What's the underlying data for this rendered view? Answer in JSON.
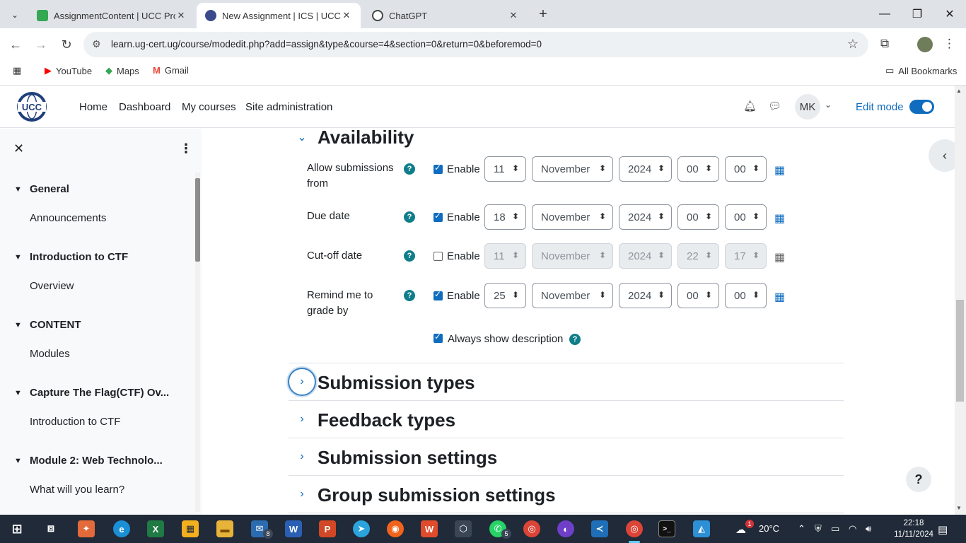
{
  "browser": {
    "tabs": [
      {
        "title": "AssignmentContent | UCC Proje",
        "active": false,
        "icon_color": "#34a853"
      },
      {
        "title": "New Assignment | ICS | UCC-CC",
        "active": true,
        "icon_color": "#3b4a8c"
      },
      {
        "title": "ChatGPT",
        "active": false,
        "icon_color": "#444444"
      }
    ],
    "url_host": "learn.ug-cert.ug",
    "url_path": "/course/modedit.php?add=assign&type=course=4&section=0&return=0&beforemod=0",
    "url_full": "learn.ug-cert.ug/course/modedit.php?add=assign&type&course=4&section=0&return=0&beforemod=0",
    "bookmarks": [
      {
        "label": "YouTube",
        "icon": "youtube-icon"
      },
      {
        "label": "Maps",
        "icon": "maps-icon"
      },
      {
        "label": "Gmail",
        "icon": "gmail-icon"
      }
    ],
    "all_bookmarks": "All Bookmarks"
  },
  "navbar": {
    "logo_text": "UCC",
    "links": [
      "Home",
      "Dashboard",
      "My courses",
      "Site administration"
    ],
    "user_initials": "MK",
    "edit_mode_label": "Edit mode",
    "edit_mode_on": true
  },
  "drawer": {
    "sections": [
      {
        "title": "General",
        "items": [
          "Announcements"
        ]
      },
      {
        "title": "Introduction to CTF",
        "items": [
          "Overview"
        ]
      },
      {
        "title": "CONTENT",
        "items": [
          "Modules"
        ]
      },
      {
        "title": "Capture The Flag(CTF) Ov...",
        "items": [
          "Introduction to CTF"
        ]
      },
      {
        "title": "Module 2: Web Technolo...",
        "items": [
          "What will you learn?"
        ]
      }
    ]
  },
  "availability": {
    "title": "Availability",
    "enable_label": "Enable",
    "rows": [
      {
        "label": "Allow submissions from",
        "enabled": true,
        "day": "11",
        "month": "November",
        "year": "2024",
        "hour": "00",
        "minute": "00"
      },
      {
        "label": "Due date",
        "enabled": true,
        "day": "18",
        "month": "November",
        "year": "2024",
        "hour": "00",
        "minute": "00"
      },
      {
        "label": "Cut-off date",
        "enabled": false,
        "day": "11",
        "month": "November",
        "year": "2024",
        "hour": "22",
        "minute": "17"
      },
      {
        "label": "Remind me to grade by",
        "enabled": true,
        "day": "25",
        "month": "November",
        "year": "2024",
        "hour": "00",
        "minute": "00"
      }
    ],
    "always_show_description": "Always show description"
  },
  "collapsed_sections": [
    "Submission types",
    "Feedback types",
    "Submission settings",
    "Group submission settings"
  ],
  "taskbar": {
    "weather": "20°C",
    "time": "22:18",
    "date": "11/11/2024",
    "mail_badge": "8",
    "whatsapp_badge": "5",
    "weather_badge": "1"
  },
  "colors": {
    "accent": "#0f6cbf",
    "help": "#0f7e8a",
    "taskbar": "#202a38"
  }
}
